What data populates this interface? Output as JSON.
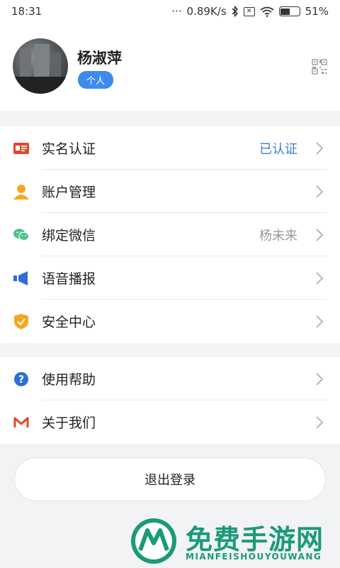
{
  "status_bar": {
    "time": "18:31",
    "dots": "···",
    "network_speed": "0.89K/s",
    "battery_text": "51%",
    "battery_level": 0.51
  },
  "profile": {
    "name": "杨淑萍",
    "tag": "个人"
  },
  "groups": [
    {
      "items": [
        {
          "label": "实名认证",
          "value": "已认证",
          "icon": "id-card-icon",
          "color": "#e2452f"
        },
        {
          "label": "账户管理",
          "value": "",
          "icon": "user-icon",
          "color": "#f6a623"
        },
        {
          "label": "绑定微信",
          "value": "杨未来",
          "icon": "wechat-icon",
          "color": "#4cc08a"
        },
        {
          "label": "语音播报",
          "value": "",
          "icon": "speaker-icon",
          "color": "#2f6ed8"
        },
        {
          "label": "安全中心",
          "value": "",
          "icon": "shield-icon",
          "color": "#f5a623"
        }
      ]
    },
    {
      "items": [
        {
          "label": "使用帮助",
          "value": "",
          "icon": "help-icon",
          "color": "#2f6ed8"
        },
        {
          "label": "关于我们",
          "value": "",
          "icon": "mail-m-icon",
          "color": "#e2452f"
        }
      ]
    }
  ],
  "logout": {
    "label": "退出登录"
  },
  "watermark": {
    "title": "免费手游网",
    "subtitle": "MIANFEISHOUYOUWANG"
  }
}
